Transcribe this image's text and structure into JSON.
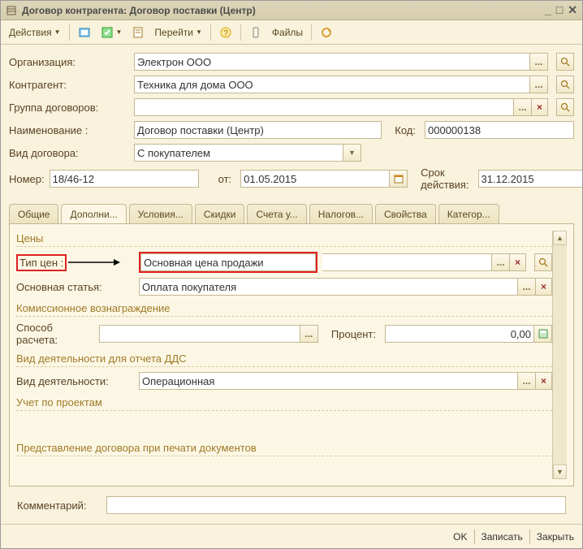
{
  "titlebar": {
    "title": "Договор контрагента: Договор поставки (Центр)"
  },
  "toolbar": {
    "actions": "Действия",
    "go": "Перейти",
    "files": "Файлы"
  },
  "form": {
    "org_label": "Организация:",
    "org_value": "Электрон ООО",
    "ka_label": "Контрагент:",
    "ka_value": "Техника для дома ООО",
    "grp_label": "Группа договоров:",
    "grp_value": "",
    "name_label": "Наименование :",
    "name_value": "Договор поставки (Центр)",
    "code_label": "Код:",
    "code_value": "000000138",
    "kind_label": "Вид договора:",
    "kind_value": "С покупателем",
    "num_label": "Номер:",
    "num_value": "18/46-12",
    "from_label": "от:",
    "from_value": "01.05.2015",
    "until_label": "Срок действия:",
    "until_value": "31.12.2015"
  },
  "tabs": [
    "Общие",
    "Дополни...",
    "Условия...",
    "Скидки",
    "Счета у...",
    "Налогов...",
    "Свойства",
    "Категор..."
  ],
  "panel": {
    "prices_hdr": "Цены",
    "price_type_label": "Тип цен :",
    "price_type_value": "Основная цена продажи",
    "main_item_label": "Основная статья:",
    "main_item_value": "Оплата покупателя",
    "commission_hdr": "Комиссионное вознаграждение",
    "calc_method_label": "Способ расчета:",
    "calc_method_value": "",
    "percent_label": "Процент:",
    "percent_value": "0,00",
    "dds_hdr": "Вид деятельности для отчета ДДС",
    "activity_label": "Вид деятельности:",
    "activity_value": "Операционная",
    "projects_hdr": "Учет по проектам",
    "print_hdr": "Представление договора при печати документов"
  },
  "comment_label": "Комментарий:",
  "comment_value": "",
  "footer": {
    "ok": "OK",
    "save": "Записать",
    "close": "Закрыть"
  }
}
